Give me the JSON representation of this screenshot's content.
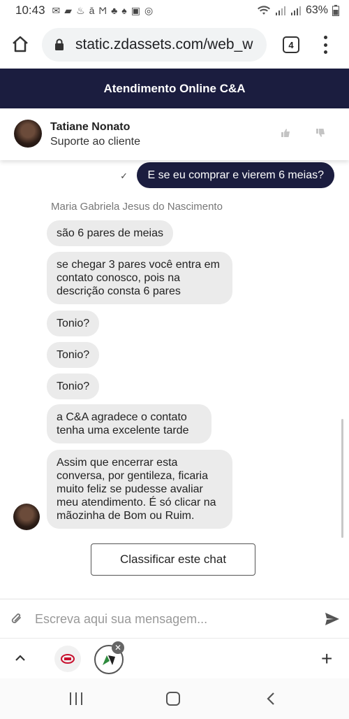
{
  "status_bar": {
    "time": "10:43",
    "battery": "63%",
    "notification_icons": [
      "mail-icon",
      "message-icon",
      "fire-icon",
      "amazon-icon",
      "mercado-icon",
      "hands-icon",
      "tree-icon",
      "photo-icon",
      "whatsapp-icon"
    ]
  },
  "browser": {
    "url": "static.zdassets.com/web_w",
    "tab_count": "4"
  },
  "chat": {
    "header_title": "Atendimento Online C&A",
    "agent": {
      "name": "Tatiane Nonato",
      "role": "Suporte ao cliente"
    },
    "outgoing_message": "E se eu comprar e vierem 6 meias?",
    "sender_name": "Maria Gabriela Jesus do Nascimento",
    "incoming_messages": [
      "são 6 pares de meias",
      "se chegar 3 pares você entra em contato conosco, pois na descrição consta 6 pares",
      "Tonio?",
      "Tonio?",
      "Tonio?",
      "a C&A agradece o contato tenha uma excelente tarde",
      "Assim que encerrar esta conversa, por gentileza, ficaria muito feliz se pudesse avaliar meu atendimento. É só clicar na mãozinha de Bom ou Ruim."
    ],
    "rate_button": "Classificar este chat",
    "input_placeholder": "Escreva aqui sua mensagem..."
  },
  "colors": {
    "header_bg": "#1b1d3f",
    "outgoing_bubble": "#1b1d3f",
    "incoming_bubble": "#ebebeb"
  }
}
